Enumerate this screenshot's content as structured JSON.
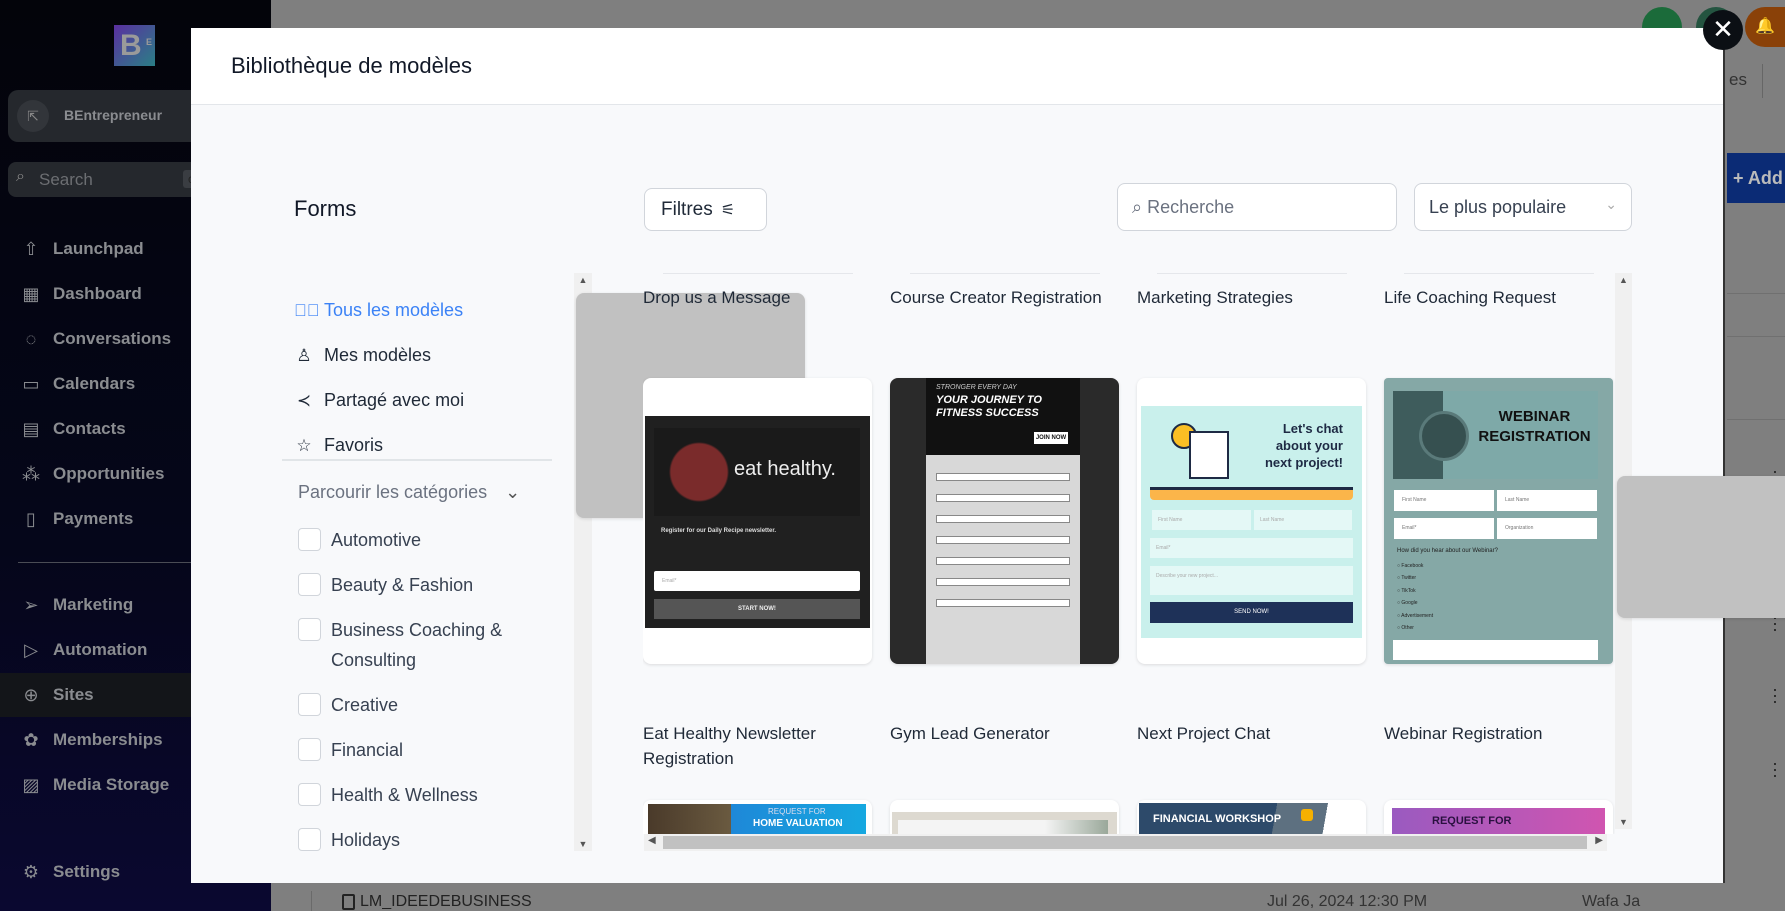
{
  "sidebar": {
    "logo": "B",
    "logo_sub": "E",
    "account": "BEntrepreneur",
    "search_placeholder": "Search",
    "search_shortcut": "ct",
    "items": [
      {
        "label": "Launchpad",
        "icon": "rocket-icon"
      },
      {
        "label": "Dashboard",
        "icon": "grid-icon"
      },
      {
        "label": "Conversations",
        "icon": "chat-icon"
      },
      {
        "label": "Calendars",
        "icon": "calendar-icon"
      },
      {
        "label": "Contacts",
        "icon": "contacts-icon"
      },
      {
        "label": "Opportunities",
        "icon": "opportunities-icon"
      },
      {
        "label": "Payments",
        "icon": "payments-icon"
      },
      {
        "label": "Marketing",
        "icon": "send-icon"
      },
      {
        "label": "Automation",
        "icon": "automation-icon"
      },
      {
        "label": "Sites",
        "icon": "sites-icon",
        "active": true
      },
      {
        "label": "Memberships",
        "icon": "badge-icon"
      },
      {
        "label": "Media Storage",
        "icon": "image-icon"
      },
      {
        "label": "Settings",
        "icon": "gear-icon"
      }
    ]
  },
  "background": {
    "tab_partial": "es",
    "add_button": "Add",
    "row": {
      "name": "LM_IDEEDEBUSINESS",
      "date": "Jul 26, 2024 12:30 PM",
      "owner": "Wafa Ja"
    }
  },
  "modal": {
    "title": "Bibliothèque de modèles",
    "section": "Forms",
    "nav": [
      {
        "label": "Tous les modèles",
        "icon": "check-circle-icon",
        "active": true
      },
      {
        "label": "Mes modèles",
        "icon": "user-icon"
      },
      {
        "label": "Partagé avec moi",
        "icon": "share-icon"
      },
      {
        "label": "Favoris",
        "icon": "star-icon"
      }
    ],
    "browse_label": "Parcourir les catégories",
    "categories": [
      "Automotive",
      "Beauty & Fashion",
      "Business Coaching & Consulting",
      "Creative",
      "Financial",
      "Health & Wellness",
      "Holidays"
    ],
    "filters_label": "Filtres",
    "search_placeholder": "Recherche",
    "sort_value": "Le plus populaire",
    "row1_titles": [
      "Drop us a Message",
      "Course Creator Registration",
      "Marketing Strategies",
      "Life Coaching Request"
    ],
    "row2": [
      {
        "title": "Eat Healthy Newsletter Registration",
        "thumb_heading": "eat healthy.",
        "thumb_text": "Register for our Daily Recipe newsletter.",
        "thumb_field": "Email*",
        "thumb_button": "START NOW!"
      },
      {
        "title": "Gym Lead Generator",
        "thumb_kicker": "STRONGER EVERY DAY",
        "thumb_heading": "YOUR JOURNEY TO FITNESS SUCCESS",
        "thumb_button": "JOIN NOW"
      },
      {
        "title": "Next Project Chat",
        "thumb_heading": "Let's chat about your next project!",
        "thumb_fields": [
          "First Name",
          "Last Name",
          "Email*",
          "Describe your new project..."
        ],
        "thumb_button": "SEND NOW!"
      },
      {
        "title": "Webinar Registration",
        "thumb_heading": "WEBINAR REGISTRATION",
        "thumb_fields": [
          "First Name",
          "Last Name",
          "Email*",
          "Organization"
        ],
        "thumb_question": "How did you hear about our Webinar?",
        "thumb_options": [
          "Facebook",
          "Twitter",
          "TikTok",
          "Google",
          "Advertisement",
          "Other"
        ]
      }
    ],
    "row3": [
      {
        "thumb_heading": "REQUEST FOR",
        "thumb_sub": "HOME VALUATION"
      },
      {
        "thumb_heading": ""
      },
      {
        "thumb_heading": "FINANCIAL WORKSHOP"
      },
      {
        "thumb_heading": "REQUEST FOR"
      }
    ]
  },
  "colors": {
    "accent": "#3b82f6",
    "overlay": "#7f7f7f",
    "sidebar": "#03040a"
  }
}
